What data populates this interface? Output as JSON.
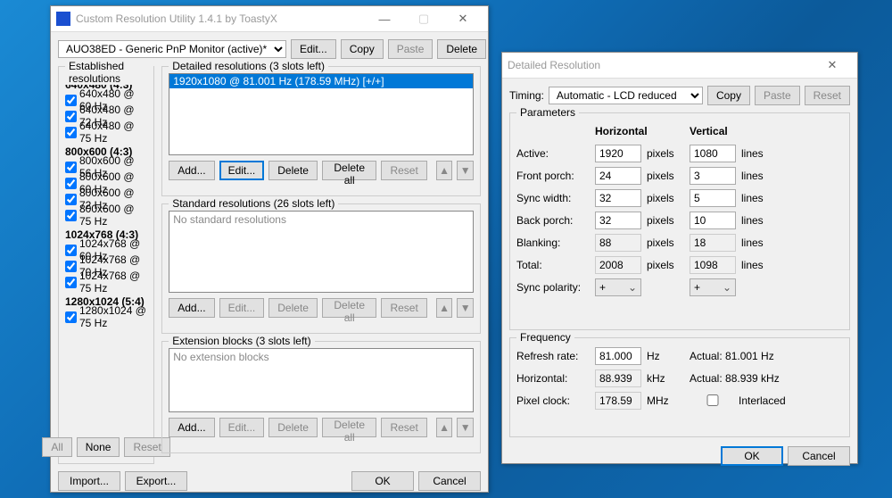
{
  "main": {
    "title": "Custom Resolution Utility 1.4.1 by ToastyX",
    "monitor": "AUO38ED - Generic PnP Monitor (active)*",
    "topbtns": {
      "edit": "Edit...",
      "copy": "Copy",
      "paste": "Paste",
      "delete": "Delete"
    },
    "established": {
      "legend": "Established resolutions",
      "groups": [
        {
          "h": "640x480 (4:3)",
          "items": [
            "640x480 @ 60 Hz",
            "640x480 @ 72 Hz",
            "640x480 @ 75 Hz"
          ]
        },
        {
          "h": "800x600 (4:3)",
          "items": [
            "800x600 @ 56 Hz",
            "800x600 @ 60 Hz",
            "800x600 @ 72 Hz",
            "800x600 @ 75 Hz"
          ]
        },
        {
          "h": "1024x768 (4:3)",
          "items": [
            "1024x768 @ 60 Hz",
            "1024x768 @ 70 Hz",
            "1024x768 @ 75 Hz"
          ]
        },
        {
          "h": "1280x1024 (5:4)",
          "items": [
            "1280x1024 @ 75 Hz"
          ]
        }
      ],
      "btns": {
        "all": "All",
        "none": "None",
        "reset": "Reset"
      }
    },
    "detailed": {
      "legend": "Detailed resolutions (3 slots left)",
      "item": "1920x1080 @ 81.001 Hz (178.59 MHz) [+/+]"
    },
    "standard": {
      "legend": "Standard resolutions (26 slots left)",
      "empty": "No standard resolutions"
    },
    "ext": {
      "legend": "Extension blocks (3 slots left)",
      "empty": "No extension blocks"
    },
    "listbtns": {
      "add": "Add...",
      "edit": "Edit...",
      "delete": "Delete",
      "deleteall": "Delete all",
      "reset": "Reset"
    },
    "bottom": {
      "import": "Import...",
      "export": "Export...",
      "ok": "OK",
      "cancel": "Cancel"
    }
  },
  "dlg": {
    "title": "Detailed Resolution",
    "timing_lbl": "Timing:",
    "timing": "Automatic - LCD reduced",
    "btns": {
      "copy": "Copy",
      "paste": "Paste",
      "reset": "Reset"
    },
    "params": {
      "legend": "Parameters",
      "hcol": "Horizontal",
      "vcol": "Vertical",
      "rows": [
        {
          "l": "Active:",
          "h": "1920",
          "hu": "pixels",
          "v": "1080",
          "vu": "lines"
        },
        {
          "l": "Front porch:",
          "h": "24",
          "hu": "pixels",
          "v": "3",
          "vu": "lines"
        },
        {
          "l": "Sync width:",
          "h": "32",
          "hu": "pixels",
          "v": "5",
          "vu": "lines"
        },
        {
          "l": "Back porch:",
          "h": "32",
          "hu": "pixels",
          "v": "10",
          "vu": "lines"
        },
        {
          "l": "Blanking:",
          "h": "88",
          "hu": "pixels",
          "v": "18",
          "vu": "lines"
        },
        {
          "l": "Total:",
          "h": "2008",
          "hu": "pixels",
          "v": "1098",
          "vu": "lines"
        }
      ],
      "sync": "Sync polarity:",
      "plus": "+"
    },
    "freq": {
      "legend": "Frequency",
      "rr_lbl": "Refresh rate:",
      "rr": "81.000",
      "rr_u": "Hz",
      "rr_act": "Actual: 81.001 Hz",
      "h_lbl": "Horizontal:",
      "h": "88.939",
      "h_u": "kHz",
      "h_act": "Actual: 88.939 kHz",
      "p_lbl": "Pixel clock:",
      "p": "178.59",
      "p_u": "MHz",
      "int": "Interlaced"
    },
    "ok": "OK",
    "cancel": "Cancel"
  }
}
